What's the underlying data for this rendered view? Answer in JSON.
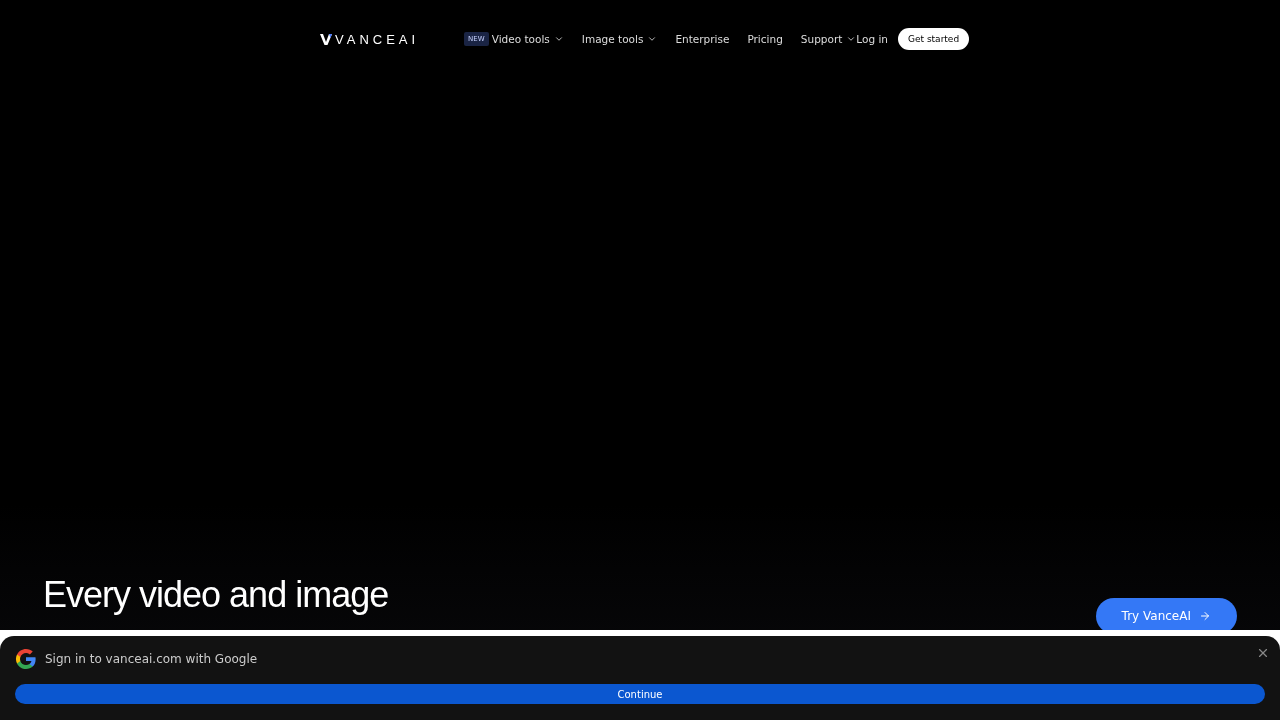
{
  "nav": {
    "logo": "VANCEAI",
    "items": [
      {
        "label": "Video tools",
        "badge": "NEW",
        "dropdown": true
      },
      {
        "label": "Image tools",
        "dropdown": true
      },
      {
        "label": "Enterprise",
        "dropdown": false
      },
      {
        "label": "Pricing",
        "dropdown": false
      },
      {
        "label": "Support",
        "dropdown": true
      }
    ],
    "login": "Log in",
    "cta": "Get started"
  },
  "hero": {
    "heading": "Every video and image",
    "button": "Try VanceAI"
  },
  "google_prompt": {
    "title": "Sign in to vanceai.com with Google",
    "button": "Continue"
  }
}
